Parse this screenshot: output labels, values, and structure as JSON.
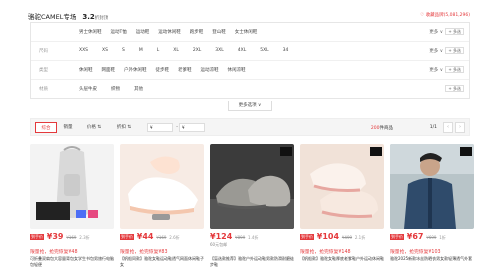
{
  "header": {
    "store_name": "骆驼CAMEL专场",
    "discount": "3.2",
    "discount_unit": "折封顶",
    "favorite": "♡ 收藏品牌(5,081,296)"
  },
  "filters": [
    {
      "label": "",
      "options": [
        "男士休闲鞋",
        "运动T恤",
        "运动鞋",
        "运动休闲鞋",
        "跑步鞋",
        "登山鞋",
        "女士休闲鞋"
      ],
      "more": "更多 ∨",
      "multi": "+ 多选"
    },
    {
      "label": "尺码",
      "options": [
        "XXS",
        "XS",
        "S",
        "M",
        "L",
        "XL",
        "2XL",
        "3XL",
        "4XL",
        "5XL",
        "34"
      ],
      "more": "更多 ∨",
      "multi": "+ 多选"
    },
    {
      "label": "类型",
      "options": [
        "休闲鞋",
        "网面鞋",
        "户外休闲鞋",
        "徒步鞋",
        "老爹鞋",
        "运动凉鞋",
        "休闲凉鞋"
      ],
      "more": "更多 ∨",
      "multi": "+ 多选"
    },
    {
      "label": "材质",
      "options": [
        "头层牛皮",
        "织物",
        "其他"
      ],
      "more": "",
      "multi": "+ 多选"
    }
  ],
  "more_options": "更多选项 ∨",
  "sortbar": {
    "items": [
      "综合",
      "销量",
      "价格 ⇅",
      "折扣 ⇅"
    ],
    "price_min": "¥",
    "price_max": "¥",
    "dash": "-",
    "count_number": "200",
    "count_suffix": "件商品",
    "page": "1/1",
    "prev": "‹",
    "next": "›"
  },
  "products": [
    {
      "tag": "到手价",
      "price": "¥39",
      "orig": "¥169",
      "disc": "2.3折",
      "sub": "",
      "promo": "限量抢，抢完恢复¥48",
      "desc": "可折叠双肩包大容量背包女学生书包男旅行电脑包轻便",
      "colors": [
        "#e9e9e9",
        "#c9c9c9"
      ]
    },
    {
      "tag": "到手价",
      "price": "¥44",
      "orig": "¥169",
      "disc": "2.6折",
      "sub": "",
      "promo": "限量抢，抢完恢复¥83",
      "desc": "【帆船同款】骆驼女鞋运动鞋透气网面休闲鞋子女",
      "colors": [
        "#f6ece6",
        "#fbe0cf"
      ]
    },
    {
      "tag": "",
      "price": "¥124",
      "orig": "¥899",
      "disc": "1.4折",
      "sub": "60元包邮",
      "promo": "",
      "desc": "【盲选款推荐】骆驼户外运动鞋男款防滑耐磨徒步鞋",
      "colors": [
        "#3a3a3a",
        "#8b8b88"
      ]
    },
    {
      "tag": "到手价",
      "price": "¥104",
      "orig": "¥499",
      "disc": "2.1折",
      "sub": "",
      "promo": "限量抢，抢完恢复¥148",
      "desc": "【帆船款】骆驼女鞋厚底老爹鞋户外运动休闲鞋",
      "colors": [
        "#f3e3d9",
        "#e8d3c8"
      ]
    },
    {
      "tag": "到手价",
      "price": "¥67",
      "orig": "¥699",
      "disc": "1折",
      "sub": "",
      "promo": "限量抢，抢完恢复¥103",
      "desc": "骆驼2025新款冰丝防晒衣男女款轻薄透气外套",
      "colors": [
        "#2f4b6b",
        "#a7b5bc"
      ]
    }
  ]
}
